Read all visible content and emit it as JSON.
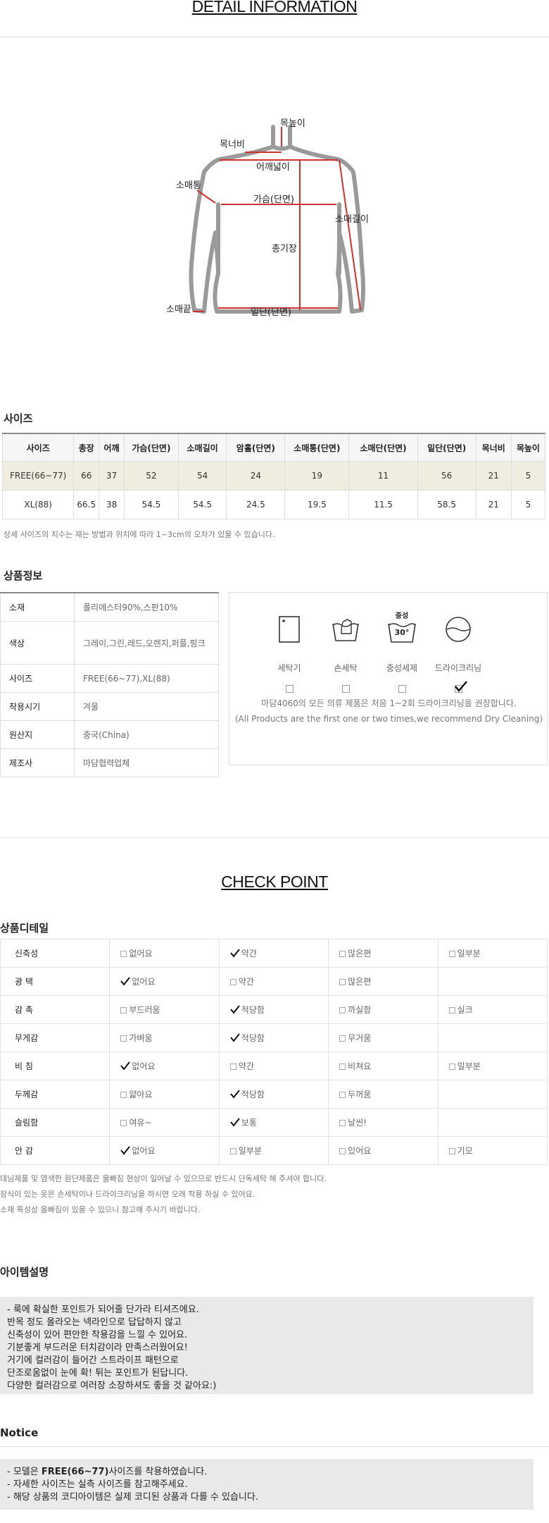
{
  "detail": {
    "title": "DETAIL INFORMATION",
    "diagram_labels": {
      "neck_height": "목높이",
      "neck_width": "목너비",
      "shoulder": "어깨넓이",
      "sleeve_width": "소매통",
      "chest": "가슴(단면)",
      "sleeve_length": "소매길이",
      "total_length": "총기장",
      "cuff": "소매끝",
      "hem": "밑단(단면)"
    }
  },
  "size_section": {
    "heading": "사이즈",
    "columns": [
      "사이즈",
      "총장",
      "어깨",
      "가슴(단면)",
      "소매길이",
      "암홀(단면)",
      "소매통(단면)",
      "소매단(단면)",
      "밑단(단면)",
      "목너비",
      "목높이"
    ],
    "rows": [
      [
        "FREE(66~77)",
        "66",
        "37",
        "52",
        "54",
        "24",
        "19",
        "11",
        "56",
        "21",
        "5"
      ],
      [
        "XL(88)",
        "66.5",
        "38",
        "54.5",
        "54.5",
        "24.5",
        "19.5",
        "11.5",
        "58.5",
        "21",
        "5"
      ]
    ],
    "note": "상세 사이즈의 치수는 재는 방법과 위치에 따라 1~3cm의 오차가 있을 수 있습니다."
  },
  "product_info": {
    "heading": "상품정보",
    "rows": [
      {
        "key": "소재",
        "value": "폴리에스터90%,스판10%"
      },
      {
        "key": "색상",
        "value": "그레이,그린,레드,오렌지,퍼플,핑크"
      },
      {
        "key": "사이즈",
        "value": "FREE(66~77),XL(88)"
      },
      {
        "key": "착용시기",
        "value": "겨울"
      },
      {
        "key": "원산지",
        "value": "중국(China)"
      },
      {
        "key": "제조사",
        "value": "마담협력업체"
      }
    ]
  },
  "washing": {
    "items": [
      {
        "icon": "washing-machine-icon",
        "label": "세탁기",
        "checked": false
      },
      {
        "icon": "hand-wash-icon",
        "label": "손세탁",
        "checked": false
      },
      {
        "icon": "neutral-detergent-icon",
        "label": "중성세제",
        "icon_top": "중성",
        "icon_temp": "30°",
        "checked": false
      },
      {
        "icon": "dry-clean-icon",
        "label": "드라이크리닝",
        "checked": true
      }
    ],
    "message_ko": "마담4060의 모든 의류 제품은 처음 1~2회 드라이크리닝을 권장합니다.",
    "message_en": "(All Products are the first one or two times,we recommend Dry Cleaning)"
  },
  "check_point": {
    "title": "CHECK POINT",
    "heading": "상품디테일",
    "rows": [
      {
        "key": "신축성",
        "options": [
          "없어요",
          "약간",
          "많은편",
          "일부분"
        ],
        "selected": 1
      },
      {
        "key": "광 택",
        "options": [
          "없어요",
          "약간",
          "많은편",
          ""
        ],
        "selected": 0
      },
      {
        "key": "감 촉",
        "options": [
          "부드러움",
          "적당함",
          "까실함",
          "실크"
        ],
        "selected": 1
      },
      {
        "key": "무게감",
        "options": [
          "가벼움",
          "적당함",
          "무거움",
          ""
        ],
        "selected": 1
      },
      {
        "key": "비 침",
        "options": [
          "없어요",
          "약간",
          "비쳐요",
          "일부분"
        ],
        "selected": 0
      },
      {
        "key": "두께감",
        "options": [
          "얇아요",
          "적당함",
          "두꺼움",
          ""
        ],
        "selected": 1
      },
      {
        "key": "슬림함",
        "options": [
          "여유~",
          "보통",
          "날씬!",
          ""
        ],
        "selected": 1
      },
      {
        "key": "안 감",
        "options": [
          "없어요",
          "일부분",
          "있어요",
          "기모"
        ],
        "selected": 0
      }
    ],
    "notes": [
      "데님제품 및 염색한 원단제품은 물빠짐 현상이 일어날 수 있으므로 반드시 단독세탁 해 주셔야 합니다.",
      "장식이 있는 옷은 손세탁이나 드라이크리닝을 하시면 오래 착용 하실 수 있어요.",
      "소재 특성상 올빠짐이 있을 수 있으니 참고해 주시기 바랍니다."
    ]
  },
  "item_desc": {
    "heading": "아이템설명",
    "lines": [
      "- 룩에 확실한 포인트가 되어줄 단가라 티셔즈에요.",
      "반목 정도 올라오는 넥라인으로 답답하지 않고",
      "신축성이 있어 편안한 착용감을 느낄 수 있어요.",
      "기분좋게 부드러운 터치감이라 만족스러웠어요!",
      "거기에 컬러감이 들어간 스트라이프 패턴으로",
      "단조로움없이 눈에 확! 튀는 포인트가 된답니다.",
      "다양한 컬러감으로 여러장 소장하셔도 좋을 것 같아요:)"
    ]
  },
  "notice": {
    "heading": "Notice",
    "line1_prefix": "- 모델은 ",
    "line1_bold": "FREE(66~77)",
    "line1_suffix": "사이즈를 착용하였습니다.",
    "line2": "- 자세한 사이즈는 실측 사이즈를 참고해주세요.",
    "line3": "- 해당 상품의 코디아이템은 실제 코디된 상품과 다를 수 있습니다."
  },
  "colors": {
    "highlight_row": "#efede0",
    "measure_line": "#d03030",
    "garment_outline": "#9a9a9a",
    "gray_box": "#e9e9e9"
  }
}
